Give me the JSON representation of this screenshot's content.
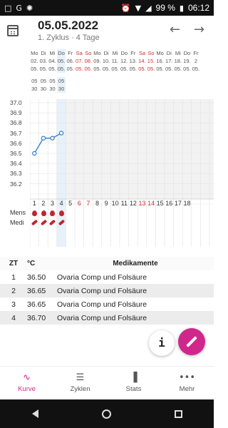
{
  "status_bar": {
    "left_icons": [
      "G",
      "★"
    ],
    "battery": "99 %",
    "time": "06:12"
  },
  "appbar": {
    "title": "05.05.2022",
    "subtitle": "1. Zyklus · 4 Tage"
  },
  "chart": {
    "weekdays": [
      "Mo",
      "Di",
      "Mi",
      "Do",
      "Fr",
      "Sa",
      "So",
      "Mo",
      "Di",
      "Mi",
      "Do",
      "Fr",
      "Sa",
      "So",
      "Mo",
      "Di",
      "Mi",
      "Do",
      "Fr"
    ],
    "dates": [
      "02.",
      "03.",
      "04.",
      "05.",
      "06.",
      "07.",
      "08.",
      "09.",
      "10.",
      "11.",
      "12.",
      "13.",
      "14.",
      "15.",
      "16.",
      "17.",
      "18.",
      "19.",
      "2"
    ],
    "months": [
      "05.",
      "05.",
      "05.",
      "05.",
      "05.",
      "05.",
      "05.",
      "05.",
      "05.",
      "05.",
      "05.",
      "05.",
      "05.",
      "05.",
      "05.",
      "05.",
      "05.",
      "05.",
      "05."
    ],
    "red_columns": [
      5,
      6,
      12,
      13
    ],
    "today_column": 3,
    "time_hours": [
      "05",
      "05",
      "05",
      "05"
    ],
    "time_minutes": [
      "30",
      "30",
      "30",
      "30"
    ],
    "y_ticks": [
      "37.0",
      "36.9",
      "36.8",
      "36.7",
      "36.6",
      "36.5",
      "36.4",
      "36.3",
      "36.2"
    ],
    "x_numbers": [
      "1",
      "2",
      "3",
      "4",
      "5",
      "6",
      "7",
      "8",
      "9",
      "10",
      "11",
      "12",
      "13",
      "14",
      "15",
      "16",
      "17",
      "18"
    ],
    "mens_label": "Mens",
    "medi_label": "Medi",
    "colors": {
      "line": "#2e7cc0",
      "red": "#d32f2f",
      "today": "#e6f1fa",
      "blood": "#c0262e"
    }
  },
  "chart_data": {
    "type": "line",
    "x": [
      1,
      2,
      3,
      4
    ],
    "values": [
      36.5,
      36.65,
      36.65,
      36.7
    ],
    "ylim": [
      36.1,
      37.0
    ]
  },
  "medtable": {
    "headers": {
      "zt": "ZT",
      "temp": "°C",
      "med": "Medikamente"
    },
    "rows": [
      {
        "zt": "1",
        "temp": "36.50",
        "med": "Ovaria Comp und Folsäure"
      },
      {
        "zt": "2",
        "temp": "36.65",
        "med": "Ovaria Comp und Folsäure"
      },
      {
        "zt": "3",
        "temp": "36.65",
        "med": "Ovaria Comp und Folsäure"
      },
      {
        "zt": "4",
        "temp": "36.70",
        "med": "Ovaria Comp und Folsäure"
      }
    ]
  },
  "fab": {
    "info_label": "i"
  },
  "bottom_nav": [
    {
      "label": "Kurve",
      "icon": "pulse-icon",
      "glyph": "∿",
      "active": true
    },
    {
      "label": "Zyklen",
      "icon": "list-icon",
      "glyph": "☰",
      "active": false
    },
    {
      "label": "Stats",
      "icon": "bar-chart-icon",
      "glyph": "▐",
      "active": false
    },
    {
      "label": "Mehr",
      "icon": "more-icon",
      "glyph": "•••",
      "active": false
    }
  ]
}
